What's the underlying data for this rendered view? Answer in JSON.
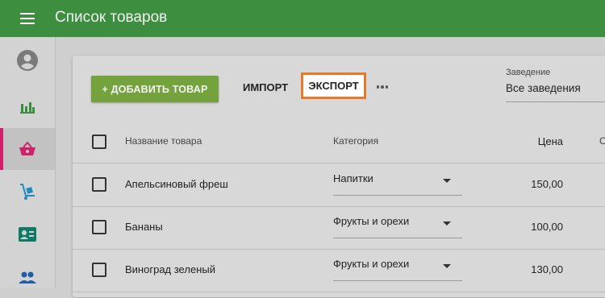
{
  "appbar": {
    "title": "Список товаров"
  },
  "sidebar": {
    "items": [
      {
        "icon": "account-icon"
      },
      {
        "icon": "bar-chart-icon"
      },
      {
        "icon": "basket-icon",
        "active": true
      },
      {
        "icon": "hand-truck-icon"
      },
      {
        "icon": "id-card-icon"
      },
      {
        "icon": "people-icon"
      }
    ]
  },
  "toolbar": {
    "add_label": "+ ДОБАВИТЬ ТОВАР",
    "import_label": "ИМПОРТ",
    "export_label": "ЭКСПОРТ"
  },
  "venue": {
    "label": "Заведение",
    "value": "Все заведения"
  },
  "table": {
    "headers": {
      "name": "Название товара",
      "category": "Категория",
      "price": "Цена",
      "extra": "С"
    },
    "rows": [
      {
        "name": "Апельсиновый фреш",
        "category": "Напитки",
        "price": "150,00"
      },
      {
        "name": "Бананы",
        "category": "Фрукты и орехи",
        "price": "100,00"
      },
      {
        "name": "Виноград зеленый",
        "category": "Фрукты и орехи",
        "price": "130,00"
      }
    ]
  },
  "colors": {
    "appbar": "#3e8e3f",
    "add_button": "#74a33e",
    "export_highlight": "#e8792b",
    "active_accent": "#d0206a"
  }
}
